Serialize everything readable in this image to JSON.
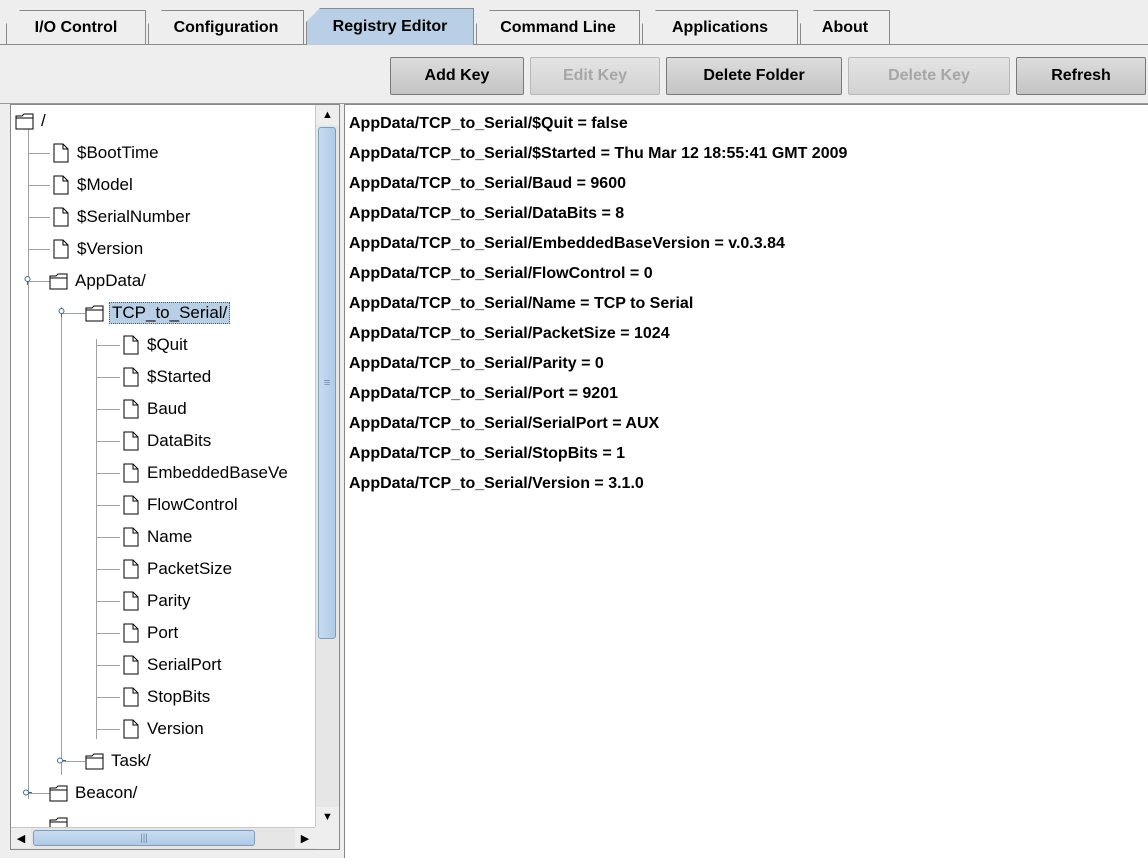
{
  "tabs": [
    {
      "label": "I/O Control",
      "active": false
    },
    {
      "label": "Configuration",
      "active": false
    },
    {
      "label": "Registry Editor",
      "active": true
    },
    {
      "label": "Command Line",
      "active": false
    },
    {
      "label": "Applications",
      "active": false
    },
    {
      "label": "About",
      "active": false
    }
  ],
  "toolbar": {
    "add_key": "Add Key",
    "edit_key": "Edit Key",
    "delete_folder": "Delete Folder",
    "delete_key": "Delete Key",
    "refresh": "Refresh"
  },
  "tree": {
    "root": "/",
    "root_items": [
      "$BootTime",
      "$Model",
      "$SerialNumber",
      "$Version"
    ],
    "appdata": "AppData/",
    "tcp": "TCP_to_Serial/",
    "tcp_items": [
      "$Quit",
      "$Started",
      "Baud",
      "DataBits",
      "EmbeddedBaseVe",
      "FlowControl",
      "Name",
      "PacketSize",
      "Parity",
      "Port",
      "SerialPort",
      "StopBits",
      "Version"
    ],
    "task": "Task/",
    "beacon": "Beacon/"
  },
  "values": [
    "AppData/TCP_to_Serial/$Quit = false",
    "AppData/TCP_to_Serial/$Started = Thu Mar 12 18:55:41 GMT 2009",
    "AppData/TCP_to_Serial/Baud = 9600",
    "AppData/TCP_to_Serial/DataBits = 8",
    "AppData/TCP_to_Serial/EmbeddedBaseVersion = v.0.3.84",
    "AppData/TCP_to_Serial/FlowControl = 0",
    "AppData/TCP_to_Serial/Name = TCP to Serial",
    "AppData/TCP_to_Serial/PacketSize = 1024",
    "AppData/TCP_to_Serial/Parity = 0",
    "AppData/TCP_to_Serial/Port = 9201",
    "AppData/TCP_to_Serial/SerialPort = AUX",
    "AppData/TCP_to_Serial/StopBits = 1",
    "AppData/TCP_to_Serial/Version = 3.1.0"
  ],
  "icons": {
    "folder": "folder-icon",
    "file": "file-icon",
    "expanded_handle": "expanded-handle-icon",
    "collapsed_handle": "collapsed-handle-icon"
  },
  "colors": {
    "selection": "#b8cfe5",
    "scroll_thumb": "#aecbe8"
  }
}
